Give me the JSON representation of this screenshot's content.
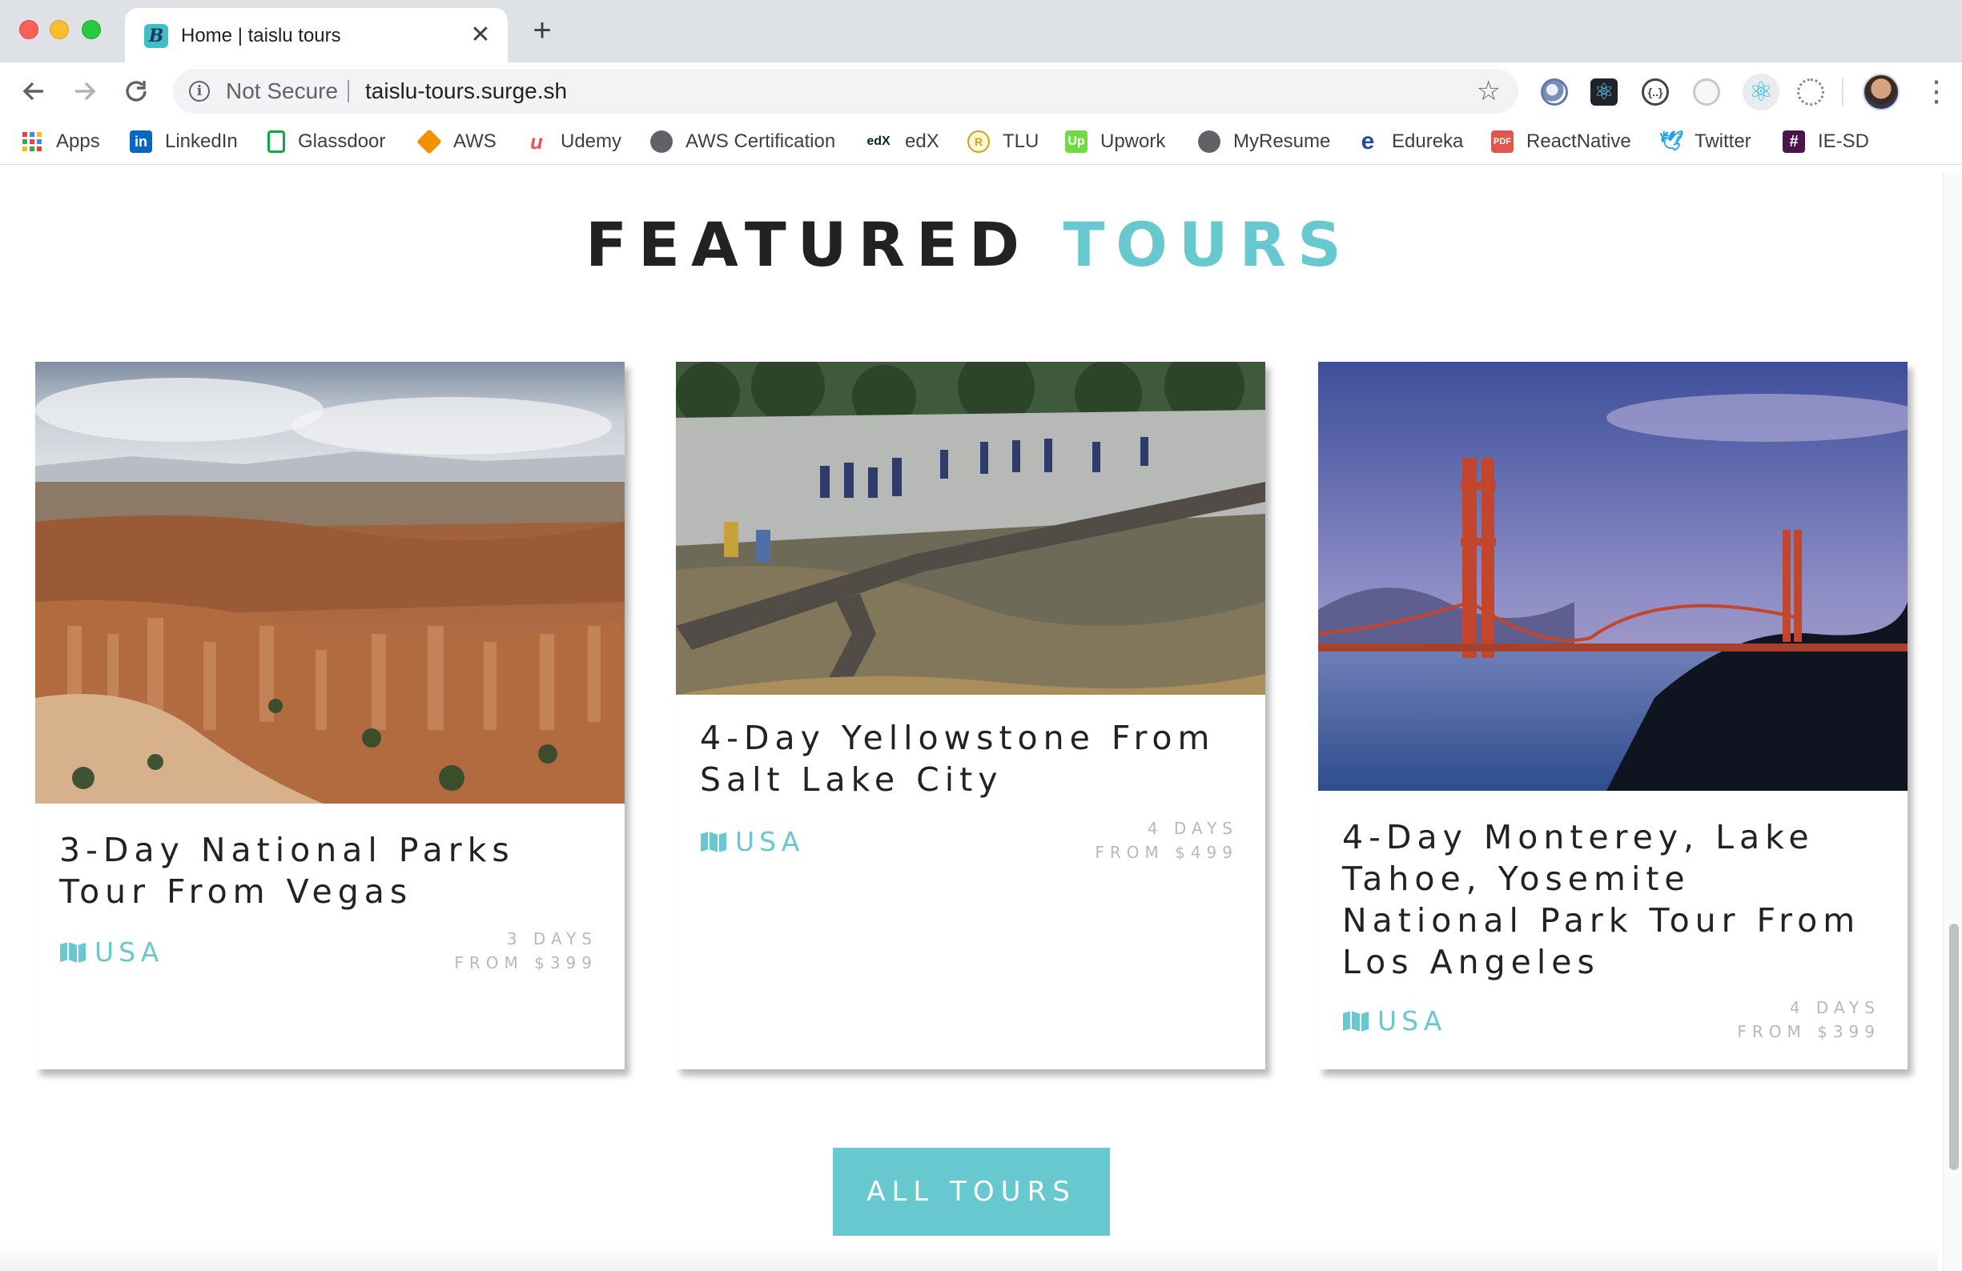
{
  "browser": {
    "tab_title": "Home | taislu tours",
    "tab_favicon_letter": "B",
    "close_glyph": "✕",
    "new_tab_glyph": "+",
    "not_secure": "Not Secure",
    "url": "taislu-tours.surge.sh",
    "bookmarks": [
      {
        "label": "Apps",
        "icon": "apps-grid-icon",
        "color": "#e8453c"
      },
      {
        "label": "LinkedIn",
        "icon": "linkedin-icon",
        "color": "#0a66c2"
      },
      {
        "label": "Glassdoor",
        "icon": "glassdoor-icon",
        "color": "#0caa41"
      },
      {
        "label": "AWS",
        "icon": "aws-icon",
        "color": "#f29100"
      },
      {
        "label": "Udemy",
        "icon": "udemy-icon",
        "color": "#ec5252"
      },
      {
        "label": "AWS Certification",
        "icon": "globe-icon",
        "color": "#5f6368"
      },
      {
        "label": "edX",
        "icon": "edx-icon",
        "color": "#02262b"
      },
      {
        "label": "TLU",
        "icon": "tlu-icon",
        "color": "#d4a017"
      },
      {
        "label": "Upwork",
        "icon": "upwork-icon",
        "color": "#6fda44"
      },
      {
        "label": "MyResume",
        "icon": "globe-icon",
        "color": "#5f6368"
      },
      {
        "label": "Edureka",
        "icon": "edureka-icon",
        "color": "#1f4e9c"
      },
      {
        "label": "ReactNative",
        "icon": "pdf-icon",
        "color": "#e2574c"
      },
      {
        "label": "Twitter",
        "icon": "twitter-icon",
        "color": "#1da1f2"
      },
      {
        "label": "IE-SD",
        "icon": "slack-icon",
        "color": "#4a154b"
      }
    ]
  },
  "featured": {
    "title_main": "FEATURED",
    "title_accent": "TOURS",
    "accent_color": "#67c9cf"
  },
  "tours": [
    {
      "name": "3-Day National Parks Tour From Vegas",
      "country": "USA",
      "days": "3 DAYS",
      "price": "FROM $399",
      "image": "bryce-canyon-photo"
    },
    {
      "name": "4-Day Yellowstone From Salt Lake City",
      "country": "USA",
      "days": "4 DAYS",
      "price": "FROM $499",
      "image": "yellowstone-boardwalk-photo"
    },
    {
      "name": "4-Day Monterey, Lake Tahoe, Yosemite National Park Tour From Los Angeles",
      "country": "USA",
      "days": "4 DAYS",
      "price": "FROM $399",
      "image": "golden-gate-bridge-photo"
    }
  ],
  "cta": {
    "all_tours": "ALL TOURS"
  }
}
